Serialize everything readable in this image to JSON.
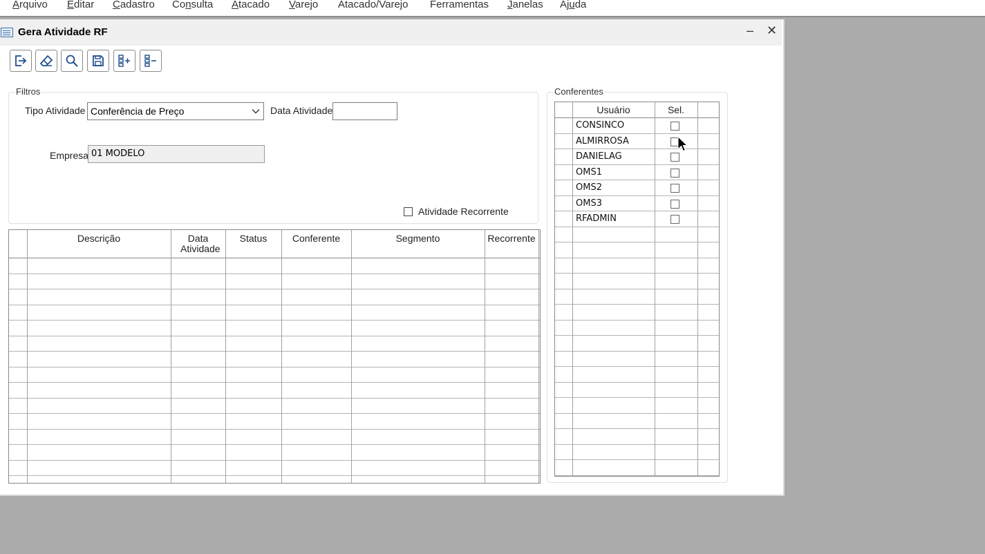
{
  "menu": [
    {
      "pre": "",
      "u": "A",
      "post": "rquivo"
    },
    {
      "pre": "",
      "u": "E",
      "post": "ditar"
    },
    {
      "pre": "",
      "u": "C",
      "post": "adastro"
    },
    {
      "pre": "Co",
      "u": "n",
      "post": "sulta"
    },
    {
      "pre": "",
      "u": "A",
      "post": "tacado"
    },
    {
      "pre": "",
      "u": "V",
      "post": "arejo"
    },
    {
      "pre": "Atacado/Varejo",
      "u": "",
      "post": ""
    },
    {
      "pre": "Ferramentas",
      "u": "",
      "post": ""
    },
    {
      "pre": "",
      "u": "J",
      "post": "anelas"
    },
    {
      "pre": "Aj",
      "u": "u",
      "post": "da"
    }
  ],
  "window": {
    "title": "Gera Atividade RF",
    "minimize": "–",
    "close": "✕"
  },
  "toolbar": [
    "exit-icon",
    "eraser-icon",
    "search-icon",
    "save-icon",
    "add-list-icon",
    "remove-list-icon"
  ],
  "filtros": {
    "label": "Filtros",
    "tipo_label": "Tipo Atividade",
    "tipo_value": "Conferência de Preço",
    "data_label": "Data Atividade",
    "data_value": "",
    "empresa_label": "Empresa",
    "empresa_value": "01 MODELO",
    "recorrente_label": "Atividade Recorrente",
    "recorrente_checked": false
  },
  "main_grid": {
    "columns": [
      {
        "label": "Descrição"
      },
      {
        "label": "Data Atividade"
      },
      {
        "label": "Status"
      },
      {
        "label": "Conferente"
      },
      {
        "label": "Segmento"
      },
      {
        "label": "Recorrente"
      }
    ]
  },
  "conferentes": {
    "label": "Conferentes",
    "columns": [
      "Usuário",
      "Sel."
    ],
    "rows": [
      {
        "usuario": "CONSINCO",
        "sel": false
      },
      {
        "usuario": "ALMIRROSA",
        "sel": false
      },
      {
        "usuario": "DANIELAG",
        "sel": false
      },
      {
        "usuario": "OMS1",
        "sel": false
      },
      {
        "usuario": "OMS2",
        "sel": false
      },
      {
        "usuario": "OMS3",
        "sel": false
      },
      {
        "usuario": "RFADMIN",
        "sel": false
      }
    ]
  }
}
